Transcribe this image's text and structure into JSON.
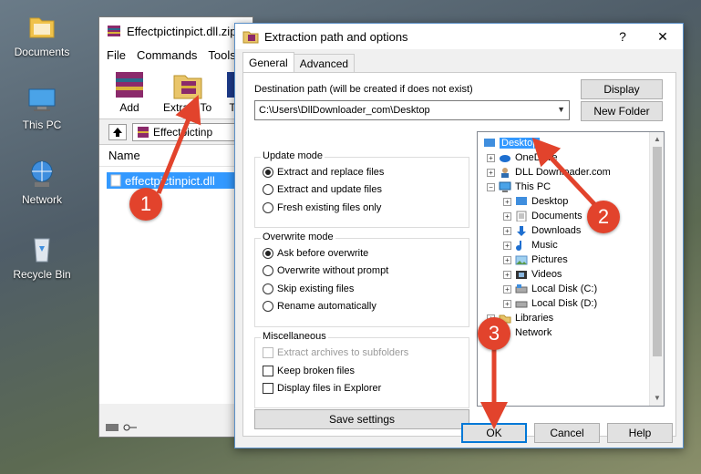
{
  "desktop": {
    "icons": [
      {
        "label": "Documents",
        "icon": "folder-icon"
      },
      {
        "label": "This PC",
        "icon": "computer-icon"
      },
      {
        "label": "Network",
        "icon": "network-icon"
      },
      {
        "label": "Recycle Bin",
        "icon": "recycle-bin-icon"
      }
    ]
  },
  "winrar": {
    "title": "Effectpictinpict.dll.zip",
    "menu": [
      "File",
      "Commands",
      "Tools"
    ],
    "toolbar": {
      "add_label": "Add",
      "extract_label": "Extract To",
      "third_label": "T"
    },
    "path_text": "Effectpictinp",
    "column_name": "Name",
    "file_name": "effectpictinpict.dll"
  },
  "dialog": {
    "title": "Extraction path and options",
    "help_symbol": "?",
    "close_symbol": "✕",
    "tabs": [
      "General",
      "Advanced"
    ],
    "destination_label": "Destination path (will be created if does not exist)",
    "destination_value": "C:\\Users\\DllDownloader_com\\Desktop",
    "display_button": "Display",
    "new_folder_button": "New Folder",
    "update_mode": {
      "title": "Update mode",
      "options": [
        "Extract and replace files",
        "Extract and update files",
        "Fresh existing files only"
      ],
      "selected": 0
    },
    "overwrite_mode": {
      "title": "Overwrite mode",
      "options": [
        "Ask before overwrite",
        "Overwrite without prompt",
        "Skip existing files",
        "Rename automatically"
      ],
      "selected": 0
    },
    "misc": {
      "title": "Miscellaneous",
      "options": [
        {
          "label": "Extract archives to subfolders",
          "checked": false,
          "disabled": true
        },
        {
          "label": "Keep broken files",
          "checked": false,
          "disabled": false
        },
        {
          "label": "Display files in Explorer",
          "checked": false,
          "disabled": false
        }
      ]
    },
    "save_settings": "Save settings",
    "tree": [
      {
        "label": "Desktop",
        "icon": "desktop-icon",
        "selected": true,
        "expander": ""
      },
      {
        "label": "OneDrive",
        "icon": "onedrive-icon",
        "selected": false,
        "expander": "+"
      },
      {
        "label": "DLL Downloader.com",
        "icon": "user-icon",
        "selected": false,
        "expander": "+"
      },
      {
        "label": "This PC",
        "icon": "computer-icon",
        "selected": false,
        "expander": "−"
      },
      {
        "label": "Desktop",
        "icon": "desktop-icon",
        "selected": false,
        "expander": "+"
      },
      {
        "label": "Documents",
        "icon": "documents-icon",
        "selected": false,
        "expander": "+"
      },
      {
        "label": "Downloads",
        "icon": "downloads-icon",
        "selected": false,
        "expander": "+"
      },
      {
        "label": "Music",
        "icon": "music-icon",
        "selected": false,
        "expander": "+"
      },
      {
        "label": "Pictures",
        "icon": "pictures-icon",
        "selected": false,
        "expander": "+"
      },
      {
        "label": "Videos",
        "icon": "videos-icon",
        "selected": false,
        "expander": "+"
      },
      {
        "label": "Local Disk (C:)",
        "icon": "disk-icon",
        "selected": false,
        "expander": "+"
      },
      {
        "label": "Local Disk (D:)",
        "icon": "disk-icon",
        "selected": false,
        "expander": "+"
      },
      {
        "label": "Libraries",
        "icon": "libraries-icon",
        "selected": false,
        "expander": "+"
      },
      {
        "label": "Network",
        "icon": "network-icon",
        "selected": false,
        "expander": "+"
      }
    ],
    "ok_button": "OK",
    "cancel_button": "Cancel",
    "help_button": "Help"
  },
  "annotations": [
    {
      "number": "1"
    },
    {
      "number": "2"
    },
    {
      "number": "3"
    }
  ],
  "colors": {
    "annotation": "#e2432c",
    "selection": "#3399ff",
    "ok_border": "#0078d7"
  }
}
